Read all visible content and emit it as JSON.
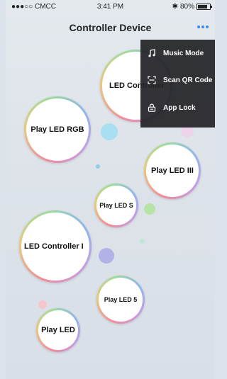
{
  "status_bar": {
    "carrier": "●●●○○ CMCC",
    "time": "3:41 PM",
    "bluetooth": "✱",
    "battery": "80%",
    "battery_level": 0.8
  },
  "nav": {
    "title": "Controller Device",
    "more_icon": "more-dots-icon"
  },
  "bubbles": [
    {
      "label": "LED Controller",
      "name": "bubble-led-controller"
    },
    {
      "label": "Play LED RGB",
      "name": "bubble-play-led-rgb"
    },
    {
      "label": "Play LED III",
      "name": "bubble-play-led-iii"
    },
    {
      "label": "Play LED S",
      "name": "bubble-play-led-s"
    },
    {
      "label": "LED Controller I",
      "name": "bubble-led-controller-i"
    },
    {
      "label": "Play LED 5",
      "name": "bubble-play-led-5"
    },
    {
      "label": "Play LED",
      "name": "bubble-play-led"
    }
  ],
  "menu": {
    "items": [
      {
        "label": "Music Mode",
        "icon": "music-note-icon"
      },
      {
        "label": "Scan QR Code",
        "icon": "scan-qr-icon"
      },
      {
        "label": "App Lock",
        "icon": "lock-icon"
      }
    ]
  },
  "colors": {
    "accent": "#3f8ce8",
    "menu_bg": "#242428",
    "menu_text": "#ffffff"
  }
}
